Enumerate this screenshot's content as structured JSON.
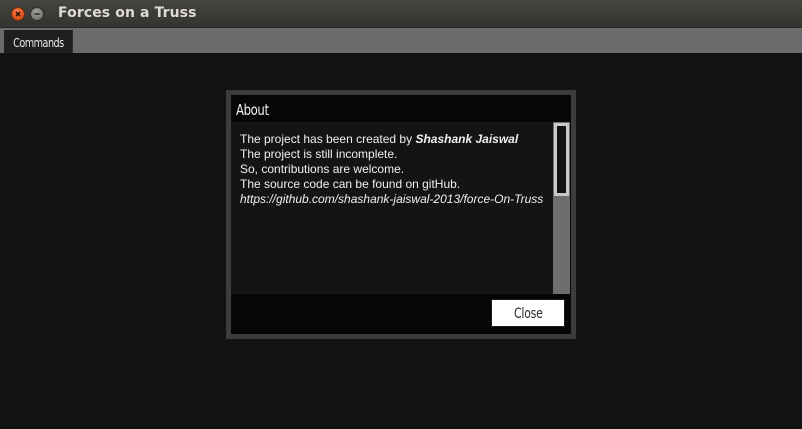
{
  "window": {
    "title": "Forces on a Truss"
  },
  "menubar": {
    "items": [
      "Commands"
    ]
  },
  "about_dialog": {
    "title": "About",
    "lines": [
      {
        "prefix": "The project has been created by ",
        "author": "Shashank Jaiswal"
      },
      {
        "text": "The project is still incomplete."
      },
      {
        "text": "So, contributions are welcome."
      },
      {
        "text": "The source code can be found on gitHub."
      },
      {
        "link": "https://github.com/shashank-jaiswal-2013/force-On-Truss"
      }
    ],
    "close_label": "Close"
  },
  "icons": {
    "window_close": "close-icon",
    "window_minimize": "minimize-icon"
  },
  "colors": {
    "close_accent": "#e2531c",
    "background": "#121212"
  }
}
